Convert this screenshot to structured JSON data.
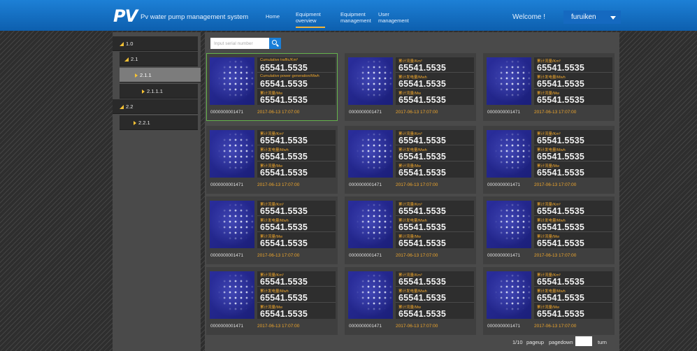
{
  "header": {
    "logo": "PV",
    "title": "Pv water pump management system",
    "nav": [
      {
        "label": "Home",
        "active": false
      },
      {
        "label": "Equipment overview",
        "active": true
      },
      {
        "label": "Equipment management",
        "active": false
      },
      {
        "label": "User management",
        "active": false
      }
    ],
    "welcome": "Welcome !",
    "user": "furuiken"
  },
  "tree": [
    {
      "label": "1.0",
      "expanded": true,
      "selected": false
    },
    {
      "label": "2.1",
      "expanded": true,
      "selected": false
    },
    {
      "label": "2.1.1",
      "expanded": false,
      "selected": true
    },
    {
      "label": "2.1.1.1",
      "expanded": false,
      "selected": false
    },
    {
      "label": "2.2",
      "expanded": true,
      "selected": false
    },
    {
      "label": "2.2.1",
      "expanded": false,
      "selected": false
    }
  ],
  "search": {
    "placeholder": "Input serial number"
  },
  "cards": [
    {
      "selected": true,
      "labels": [
        "Cumulative traffic/Km³",
        "Cumulative power generation/Mwh",
        "累计流量/Mw"
      ],
      "values": [
        "65541.5535",
        "65541.5535",
        "65541.5535"
      ],
      "serial": "0000000001471",
      "time": "2017-06-13 17:07:00"
    },
    {
      "selected": false,
      "labels": [
        "累计流量/Km³",
        "累计发电量/Mwh",
        "累计流量/Mw"
      ],
      "values": [
        "65541.5535",
        "65541.5535",
        "65541.5535"
      ],
      "serial": "0000000001471",
      "time": "2017-06-13 17:07:00"
    },
    {
      "selected": false,
      "labels": [
        "累计流量/Km³",
        "累计发电量/Mwh",
        "累计流量/Mw"
      ],
      "values": [
        "65541.5535",
        "65541.5535",
        "65541.5535"
      ],
      "serial": "0000000001471",
      "time": "2017-06-13 17:07:00"
    },
    {
      "selected": false,
      "labels": [
        "累计流量/Km³",
        "累计发电量/Mwh",
        "累计流量/Mw"
      ],
      "values": [
        "65541.5535",
        "65541.5535",
        "65541.5535"
      ],
      "serial": "0000000001471",
      "time": "2017-06-13 17:07:00"
    },
    {
      "selected": false,
      "labels": [
        "累计流量/Km³",
        "累计发电量/Mwh",
        "累计流量/Mw"
      ],
      "values": [
        "65541.5535",
        "65541.5535",
        "65541.5535"
      ],
      "serial": "0000000001471",
      "time": "2017-06-13 17:07:00"
    },
    {
      "selected": false,
      "labels": [
        "累计流量/Km³",
        "累计发电量/Mwh",
        "累计流量/Mw"
      ],
      "values": [
        "65541.5535",
        "65541.5535",
        "65541.5535"
      ],
      "serial": "0000000001471",
      "time": "2017-06-13 17:07:00"
    },
    {
      "selected": false,
      "labels": [
        "累计流量/Km³",
        "累计发电量/Mwh",
        "累计流量/Mw"
      ],
      "values": [
        "65541.5535",
        "65541.5535",
        "65541.5535"
      ],
      "serial": "0000000001471",
      "time": "2017-06-13 17:07:00"
    },
    {
      "selected": false,
      "labels": [
        "累计流量/Km³",
        "累计发电量/Mwh",
        "累计流量/Mw"
      ],
      "values": [
        "65541.5535",
        "65541.5535",
        "65541.5535"
      ],
      "serial": "0000000001471",
      "time": "2017-06-13 17:07:00"
    },
    {
      "selected": false,
      "labels": [
        "累计流量/Km³",
        "累计发电量/Mwh",
        "累计流量/Mw"
      ],
      "values": [
        "65541.5535",
        "65541.5535",
        "65541.5535"
      ],
      "serial": "0000000001471",
      "time": "2017-06-13 17:07:00"
    },
    {
      "selected": false,
      "labels": [
        "累计流量/Km³",
        "累计发电量/Mwh",
        "累计流量/Mw"
      ],
      "values": [
        "65541.5535",
        "65541.5535",
        "65541.5535"
      ],
      "serial": "0000000001471",
      "time": "2017-06-13 17:07:00"
    },
    {
      "selected": false,
      "labels": [
        "累计流量/Km³",
        "累计发电量/Mwh",
        "累计流量/Mw"
      ],
      "values": [
        "65541.5535",
        "65541.5535",
        "65541.5535"
      ],
      "serial": "0000000001471",
      "time": "2017-06-13 17:07:00"
    },
    {
      "selected": false,
      "labels": [
        "累计流量/Km³",
        "累计发电量/Mwh",
        "累计流量/Mw"
      ],
      "values": [
        "65541.5535",
        "65541.5535",
        "65541.5535"
      ],
      "serial": "0000000001471",
      "time": "2017-06-13 17:07:00"
    }
  ],
  "pagination": {
    "page": "1/10",
    "pageup": "pageup",
    "pagedown": "pagedown",
    "turn": "turn"
  },
  "colors": {
    "header": "#0d6fc4",
    "accent": "#f0a72c",
    "selected_border": "#65b34c",
    "tree_arrow": "#f5c234"
  }
}
